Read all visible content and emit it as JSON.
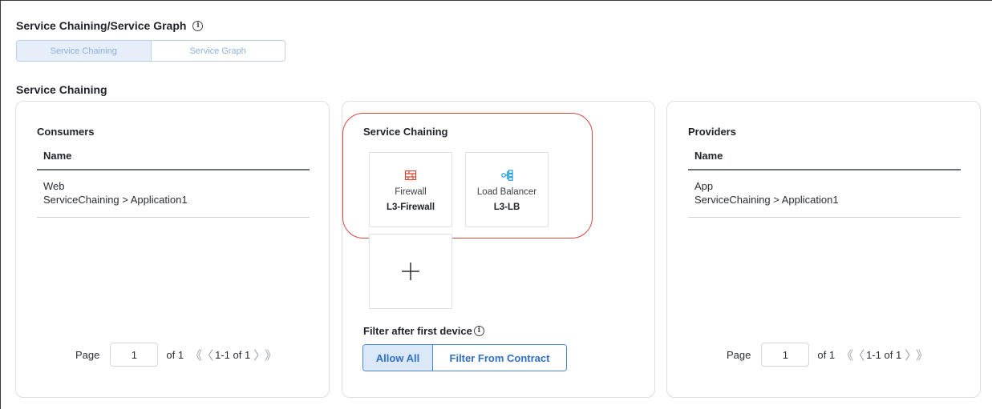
{
  "header": {
    "title": "Service Chaining/Service Graph",
    "tabs": [
      {
        "label": "Service Chaining",
        "active": true
      },
      {
        "label": "Service Graph",
        "active": false
      }
    ]
  },
  "section": {
    "title": "Service Chaining"
  },
  "consumers": {
    "title": "Consumers",
    "column": "Name",
    "rows": [
      {
        "name": "Web",
        "path": "ServiceChaining > Application1"
      }
    ],
    "pager": {
      "label": "Page",
      "value": "1",
      "of": "of 1",
      "range": "1-1 of 1"
    }
  },
  "chain": {
    "title": "Service Chaining",
    "devices": [
      {
        "type": "Firewall",
        "name": "L3-Firewall",
        "icon": "firewall-icon",
        "color": "#d9412b"
      },
      {
        "type": "Load Balancer",
        "name": "L3-LB",
        "icon": "load-balancer-icon",
        "color": "#1a9bd7"
      }
    ],
    "add_icon": "plus-icon",
    "filter": {
      "label": "Filter after first device",
      "options": [
        "Allow All",
        "Filter From Contract"
      ],
      "selected": "Allow All"
    }
  },
  "providers": {
    "title": "Providers",
    "column": "Name",
    "rows": [
      {
        "name": "App",
        "path": "ServiceChaining > Application1"
      }
    ],
    "pager": {
      "label": "Page",
      "value": "1",
      "of": "of 1",
      "range": "1-1 of 1"
    }
  },
  "colors": {
    "accent": "#4a86d4",
    "highlight": "#d94545"
  }
}
